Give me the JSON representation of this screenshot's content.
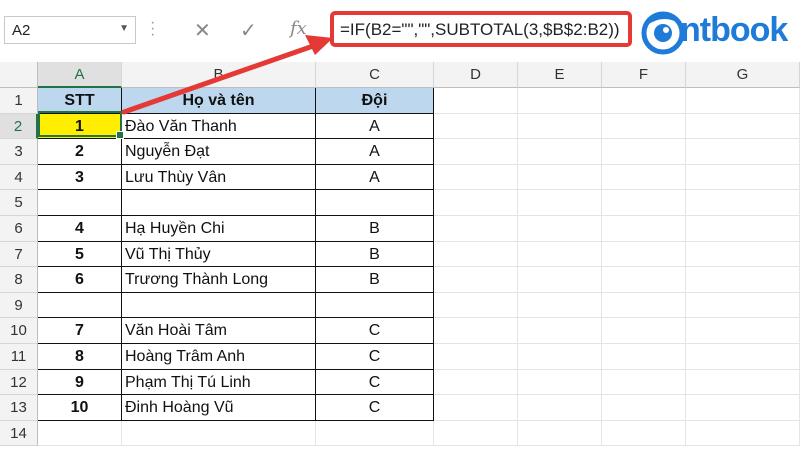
{
  "name_box": {
    "value": "A2"
  },
  "formula_bar": {
    "formula": "=IF(B2=\"\",\"\",SUBTOTAL(3,$B$2:B2))",
    "fx_label": "fx"
  },
  "logo": {
    "text": "ntbook"
  },
  "columns": [
    "A",
    "B",
    "C",
    "D",
    "E",
    "F",
    "G"
  ],
  "rows": [
    "1",
    "2",
    "3",
    "4",
    "5",
    "6",
    "7",
    "8",
    "9",
    "10",
    "11",
    "12",
    "13",
    "14"
  ],
  "table": {
    "headers": [
      "STT",
      "Họ và tên",
      "Đội"
    ],
    "data": [
      [
        "1",
        "Đào Văn Thanh",
        "A"
      ],
      [
        "2",
        "Nguyễn Đạt",
        "A"
      ],
      [
        "3",
        "Lưu Thùy Vân",
        "A"
      ],
      [
        "",
        "",
        ""
      ],
      [
        "4",
        "Hạ Huyền Chi",
        "B"
      ],
      [
        "5",
        "Vũ Thị Thủy",
        "B"
      ],
      [
        "6",
        "Trương Thành Long",
        "B"
      ],
      [
        "",
        "",
        ""
      ],
      [
        "7",
        "Văn Hoài Tâm",
        "C"
      ],
      [
        "8",
        "Hoàng Trâm Anh",
        "C"
      ],
      [
        "9",
        "Phạm Thị Tú Linh",
        "C"
      ],
      [
        "10",
        "Đinh Hoàng Vũ",
        "C"
      ]
    ]
  },
  "colors": {
    "accent": "#217346",
    "highlight": "#e53935",
    "header_fill": "#bcd7ee",
    "selected_fill": "#ffee00",
    "logo": "#1e7bd8"
  }
}
